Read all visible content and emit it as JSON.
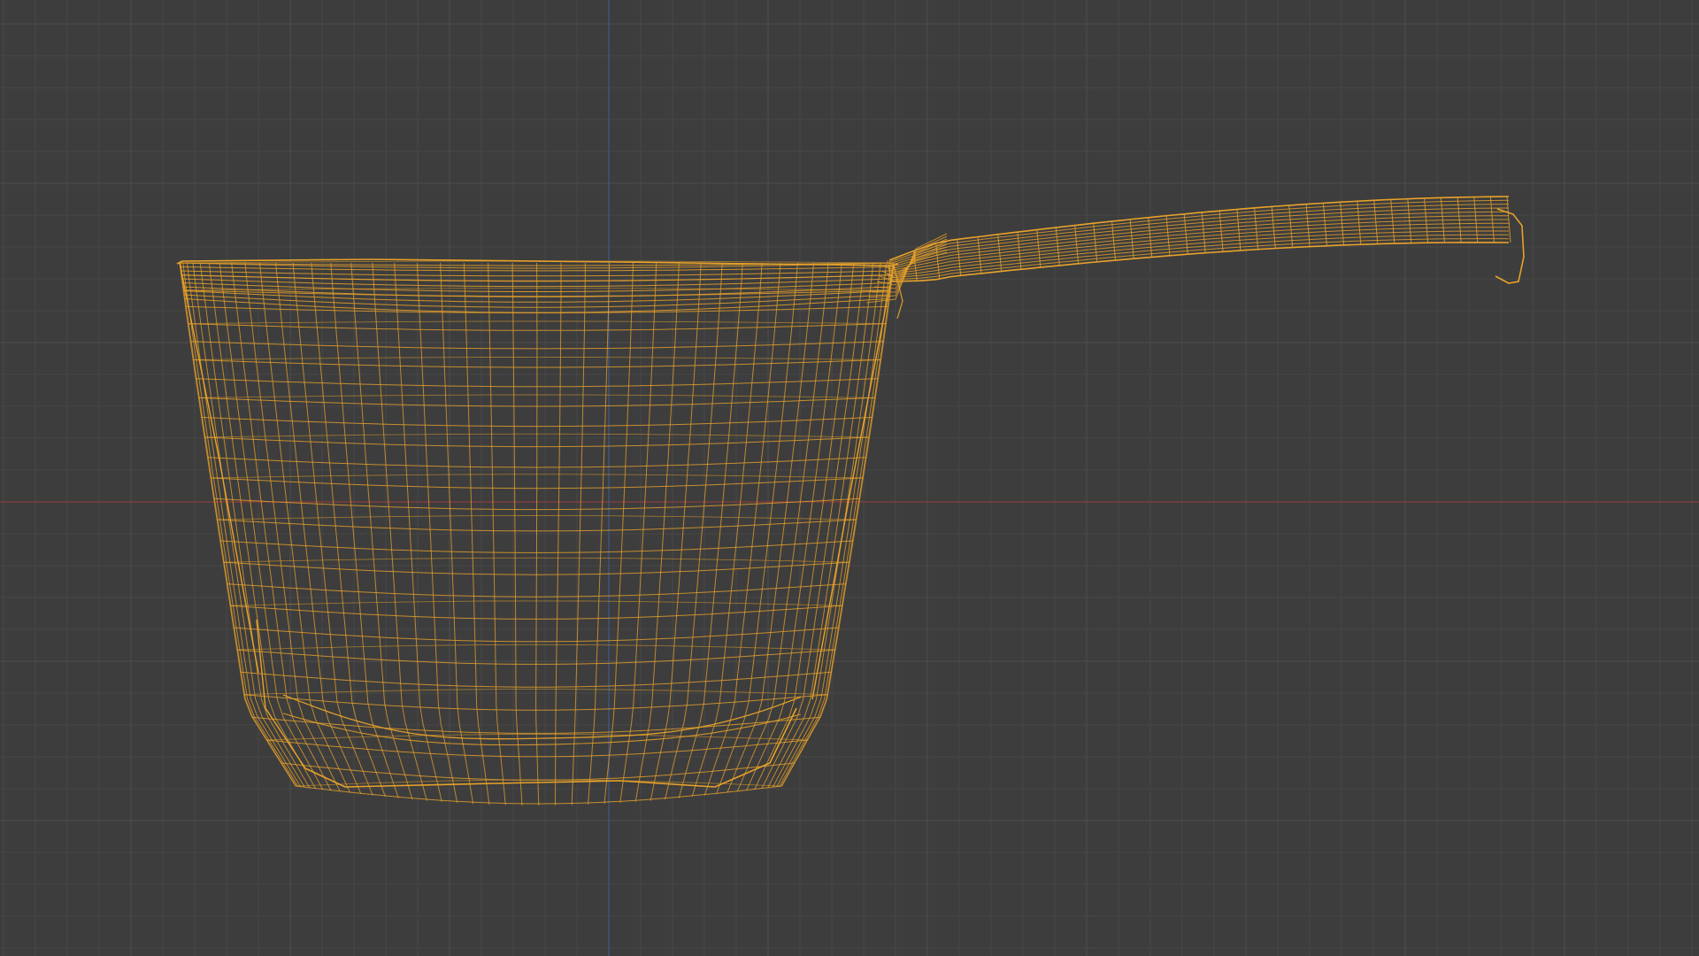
{
  "viewport": {
    "background_color": "#3d3d3d",
    "grid_minor_color": "#474747",
    "grid_major_color": "#4d4d4d",
    "axis_x_color": "#8a3c3c",
    "axis_y_color": "#3c5a8a",
    "wireframe_color": "#e8a22a",
    "shading_mode": "wireframe"
  },
  "object": {
    "icon": "saucepan-wireframe-mesh"
  }
}
